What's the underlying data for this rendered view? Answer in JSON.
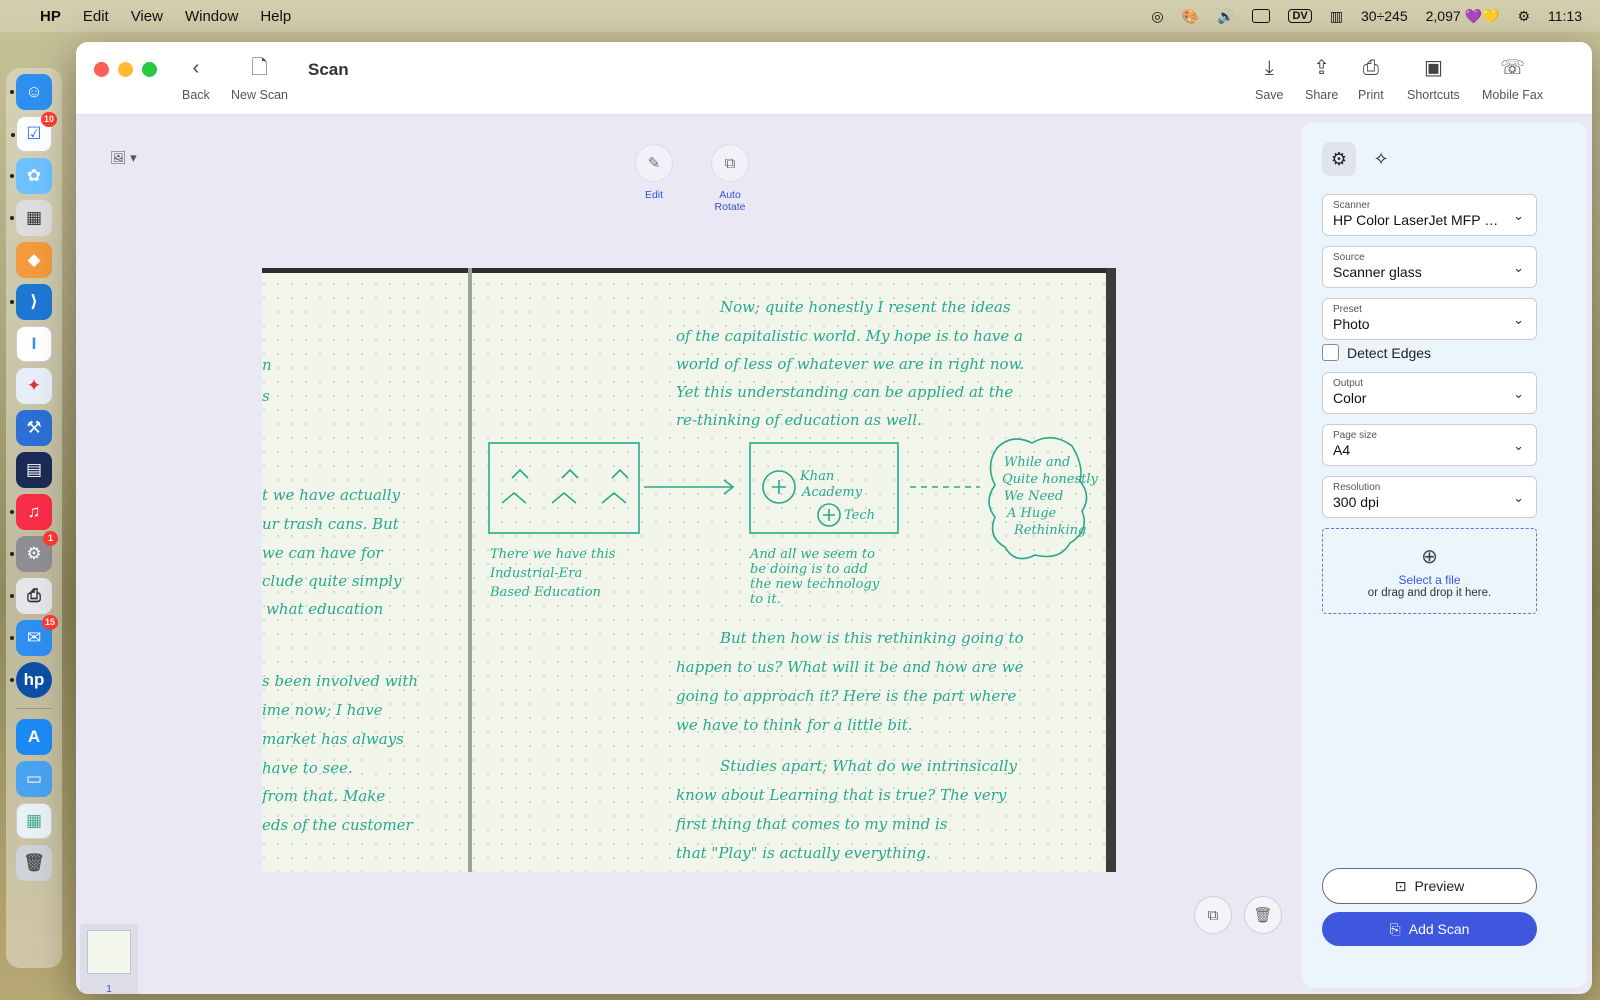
{
  "menubar": {
    "app_name": "HP",
    "menus": [
      "Edit",
      "View",
      "Window",
      "Help"
    ],
    "status_text_1": "30÷245",
    "status_text_2": "2,097",
    "dv_label": "DV",
    "clock": "11:13"
  },
  "dock": {
    "badges": {
      "reminders": "10",
      "settings": "1",
      "mail": "15"
    }
  },
  "toolbar": {
    "title": "Scan",
    "back_label": "Back",
    "new_scan_label": "New Scan",
    "save_label": "Save",
    "share_label": "Share",
    "print_label": "Print",
    "shortcuts_label": "Shortcuts",
    "mobile_fax_label": "Mobile Fax"
  },
  "tools": {
    "edit_label": "Edit",
    "auto_rotate_line1": "Auto",
    "auto_rotate_line2": "Rotate"
  },
  "scan": {
    "left_page_lines": [
      "n",
      "s",
      "t we have actually",
      "ur trash cans. But",
      "we can have for",
      "clude quite simply",
      "what education",
      "s been involved with",
      "ime now; I have",
      "market has always",
      "have to see.",
      "from that. Make",
      "eds of the customer"
    ],
    "right_page_top": [
      "Now; quite honestly I resent the ideas",
      "of the capitalistic world. My hope is to have a",
      "world of less of whatever we are in right now.",
      "Yet this understanding can be applied at the",
      "re-thinking of education as well."
    ],
    "sketch_left_caption": [
      "There we have this",
      "Industrial-Era",
      "Based Education"
    ],
    "sketch_middle_labels": [
      "Khan",
      "Academy",
      "Tech"
    ],
    "sketch_middle_caption": [
      "And all we seem to",
      "be doing is to add",
      "the new technology",
      "to it."
    ],
    "sketch_right_bubble": [
      "While and",
      "Quite honestly",
      "We Need",
      "A Huge",
      "Rethinking"
    ],
    "right_page_mid": [
      "But then how is this rethinking going to",
      "happen to us? What will it be and how are we",
      "going to approach it? Here is the part where",
      "we have to think for a little bit."
    ],
    "right_page_bottom": [
      "Studies apart; What do we intrinsically",
      "know about Learning that is true? The very",
      "first thing that comes to my mind is",
      "that \"Play\" is actually everything."
    ]
  },
  "thumbnail": {
    "page_number": "1"
  },
  "panel": {
    "scanner_label": "Scanner",
    "scanner_value": "HP Color LaserJet MFP M...",
    "source_label": "Source",
    "source_value": "Scanner glass",
    "preset_label": "Preset",
    "preset_value": "Photo",
    "detect_edges_label": "Detect Edges",
    "output_label": "Output",
    "output_value": "Color",
    "page_size_label": "Page size",
    "page_size_value": "A4",
    "resolution_label": "Resolution",
    "resolution_value": "300 dpi",
    "select_file_label": "Select a file",
    "drag_drop_label": "or drag and drop it here.",
    "preview_label": "Preview",
    "add_scan_label": "Add Scan"
  },
  "colors": {
    "accent": "#3f56df",
    "ink": "#29a88e",
    "panel_bg": "#ebf5fb",
    "canvas_bg": "#e9e8f4"
  }
}
